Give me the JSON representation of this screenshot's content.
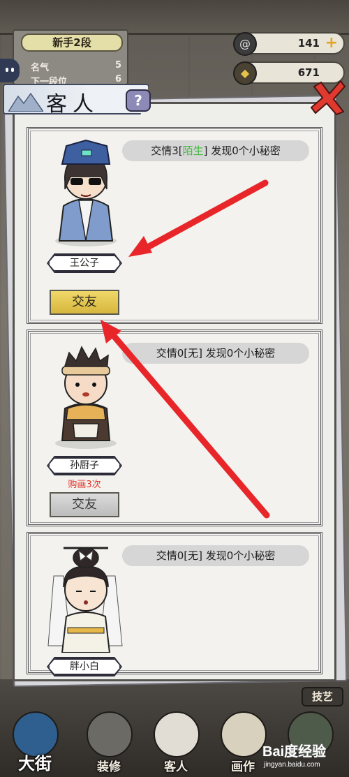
{
  "hud": {
    "rank_title": "新手2段",
    "fame_label": "名气",
    "fame_value": "5",
    "next_rank_label": "下一段位",
    "next_rank_value": "6",
    "currency_1": {
      "icon": "swirl-token-icon",
      "value": "141"
    },
    "currency_2": {
      "icon": "coin-icon",
      "value": "671"
    }
  },
  "panel": {
    "title": "客人",
    "help_label": "?"
  },
  "guests": [
    {
      "name": "王公子",
      "info_prefix": "交情3[",
      "relation": "陌生",
      "info_suffix": "] 发现0个小秘密",
      "button_label": "交友",
      "button_state": "active",
      "note": ""
    },
    {
      "name": "孙厨子",
      "info_prefix": "交情0[",
      "relation": "无",
      "info_suffix": "] 发现0个小秘密",
      "button_label": "交友",
      "button_state": "disabled",
      "note": "购画3次"
    },
    {
      "name": "胖小白",
      "info_prefix": "交情0[",
      "relation": "无",
      "info_suffix": "] 发现0个小秘密",
      "button_label": "",
      "button_state": "hidden",
      "note": ""
    }
  ],
  "nav": {
    "street": "大街",
    "decorate": "装修",
    "guests": "客人",
    "painting": "画作",
    "skill_tab": "技艺"
  },
  "watermark": {
    "brand": "Bai度经验",
    "url": "jingyan.baidu.com"
  },
  "colors": {
    "relation_green": "#3dbb3a",
    "note_red": "#e0342a",
    "arrow_red": "#e8262a",
    "button_gold": "#e2c451"
  }
}
